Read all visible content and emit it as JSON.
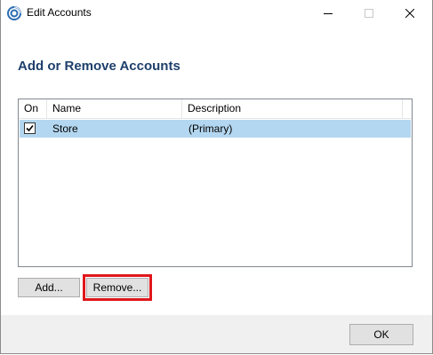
{
  "window": {
    "title": "Edit Accounts",
    "icon": "app-swirl-icon",
    "controls": {
      "minimize": "minimize-icon",
      "maximize": "maximize-icon",
      "close": "close-icon"
    }
  },
  "heading": "Add or Remove Accounts",
  "accounts_list": {
    "columns": [
      "On",
      "Name",
      "Description"
    ],
    "rows": [
      {
        "on": true,
        "name": "Store",
        "description": "(Primary)",
        "selected": true
      }
    ]
  },
  "buttons": {
    "add": "Add...",
    "remove": "Remove...",
    "ok": "OK"
  },
  "colors": {
    "heading": "#1e3f6b",
    "selection": "#b3d7f0",
    "highlight": "#e0161b"
  }
}
